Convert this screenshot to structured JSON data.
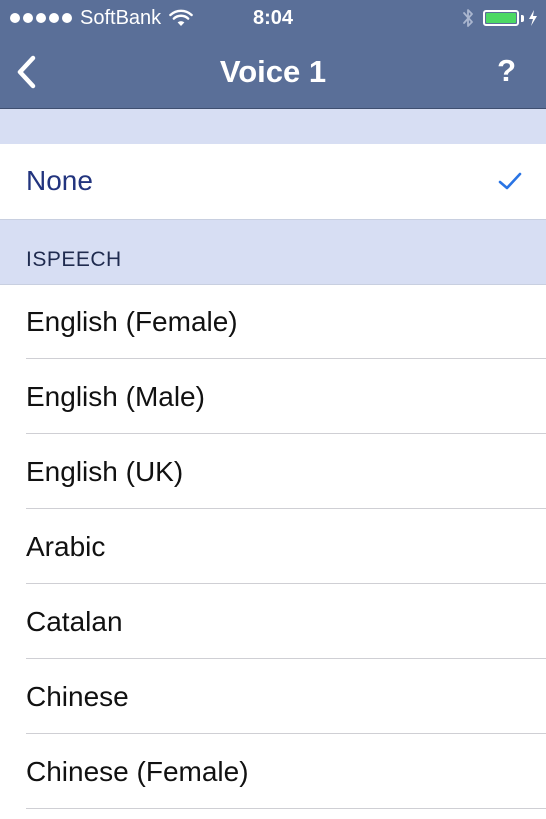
{
  "status_bar": {
    "carrier": "SoftBank",
    "time": "8:04",
    "signal_bars": 5,
    "battery_level": 1.0,
    "battery_color": "#4cd964"
  },
  "nav": {
    "title": "Voice 1",
    "back_icon": "chevron-left-icon",
    "help_label": "?"
  },
  "selected_row": {
    "label": "None",
    "checked": true,
    "check_icon": "checkmark-icon"
  },
  "section": {
    "title": "ISPEECH",
    "items": [
      {
        "label": "English (Female)"
      },
      {
        "label": "English (Male)"
      },
      {
        "label": "English (UK)"
      },
      {
        "label": "Arabic"
      },
      {
        "label": "Catalan"
      },
      {
        "label": "Chinese"
      },
      {
        "label": "Chinese (Female)"
      }
    ]
  },
  "colors": {
    "header_bg": "#5a6f98",
    "section_bg": "#d7def3",
    "accent_text": "#22347e",
    "check_color": "#2a74e4"
  }
}
